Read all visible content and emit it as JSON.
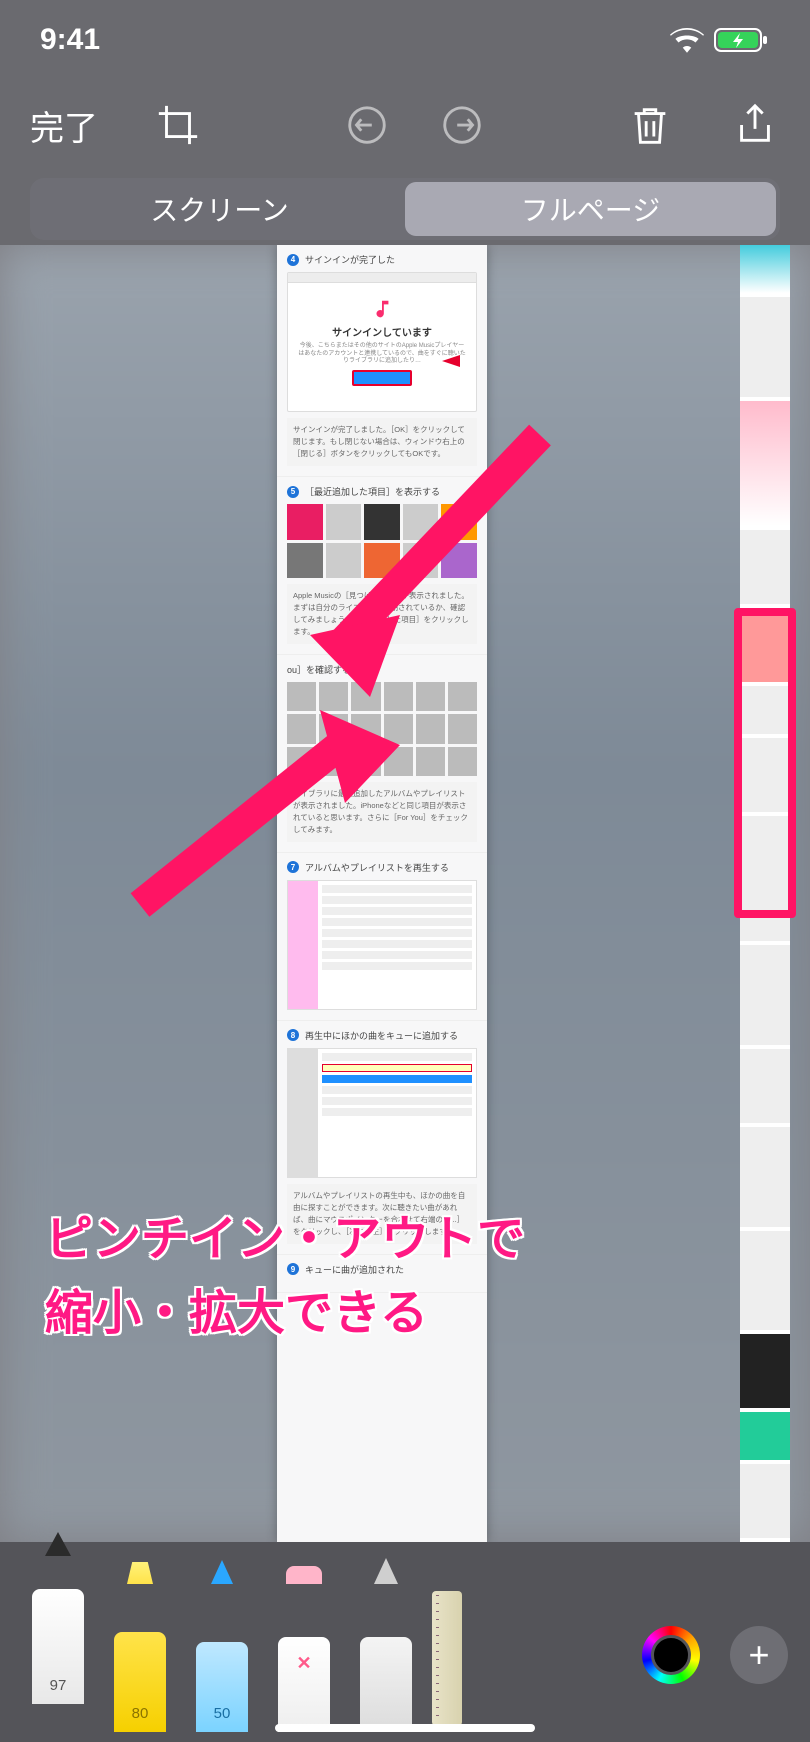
{
  "status": {
    "time": "9:41"
  },
  "toolbar": {
    "done": "完了"
  },
  "segmented": {
    "screen": "スクリーン",
    "fullpage": "フルページ"
  },
  "annotation": {
    "line1": "ピンチイン・アウトで",
    "line2": "縮小・拡大できる"
  },
  "page": {
    "sec4_num": "4",
    "sec4_title": "サインインが完了した",
    "signin_title": "サインインしています",
    "signin_sub": "今後、こちらまたはその他のサイトのApple Musicプレイヤーはあなたのアカウントと連携しているので、曲をすぐに聴いたりライブラリに追加したり…",
    "sec4_desc": "サインインが完了しました。［OK］をクリックして閉じます。もし閉じない場合は、ウィンドウ右上の［閉じる］ボタンをクリックしてもOKです。",
    "sec5_num": "5",
    "sec5_title": "［最近追加した項目］を表示する",
    "sec5_desc": "Apple Musicの［見つける］画面が表示されました。まずは自分のライブラリが同期されているか、確認してみましょう。［最近追加した項目］をクリックします。",
    "sec6_title": "ou］を確認する",
    "sec6_desc": "ライブラリに最近追加したアルバムやプレイリストが表示されました。iPhoneなどと同じ項目が表示されていると思います。さらに［For You］をチェックしてみます。",
    "sec7_num": "7",
    "sec7_title": "アルバムやプレイリストを再生する",
    "sec8_num": "8",
    "sec8_title": "再生中にほかの曲をキューに追加する",
    "sec8_desc": "アルバムやプレイリストの再生中も、ほかの曲を自由に探すことができます。次に聴きたい曲があれば、曲にマウスポインターを合わせて右端の［...］をクリックし、［次に再生］をクリックします。",
    "sec9_num": "9",
    "sec9_title": "キューに曲が追加された"
  },
  "tools": {
    "pen": "97",
    "marker": "80",
    "pencil": "50"
  }
}
